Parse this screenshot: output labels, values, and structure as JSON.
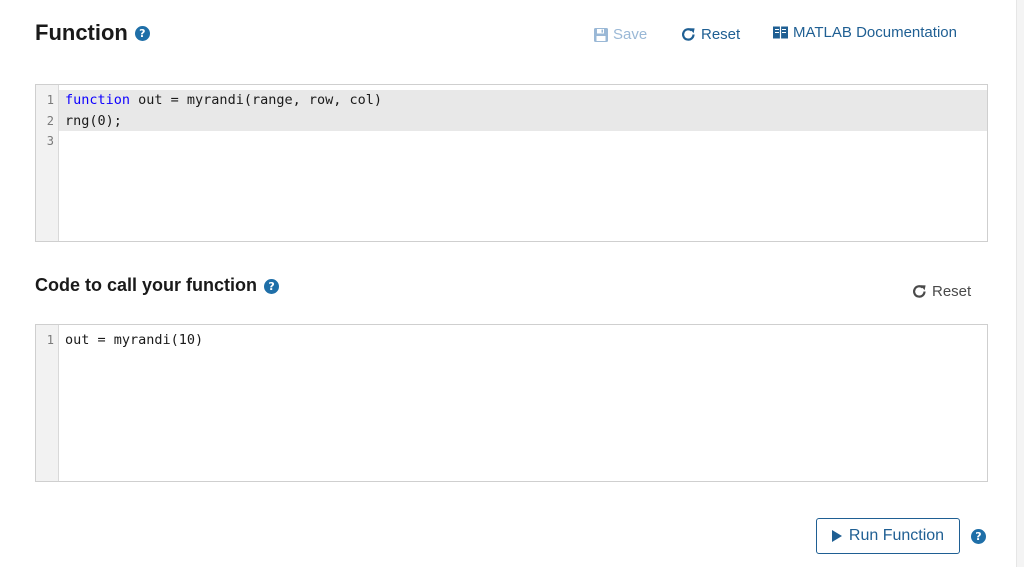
{
  "function_section": {
    "title": "Function",
    "help_glyph": "?",
    "toolbar": {
      "save_label": "Save",
      "reset_label": "Reset",
      "docs_label": "MATLAB Documentation"
    },
    "code_lines": [
      {
        "num": "1",
        "keyword": "function",
        "rest": " out = myrandi(range, row, col)"
      },
      {
        "num": "2",
        "keyword": "",
        "rest": "rng(0);"
      },
      {
        "num": "3",
        "keyword": "",
        "rest": ""
      }
    ]
  },
  "call_section": {
    "title": "Code to call your function",
    "help_glyph": "?",
    "reset_label": "Reset",
    "code_lines": [
      {
        "num": "1",
        "keyword": "",
        "rest": "out = myrandi(10)"
      }
    ]
  },
  "run": {
    "label": "Run Function",
    "help_glyph": "?"
  },
  "colors": {
    "accent": "#1f5f93",
    "help_icon": "#1f6fa8",
    "keyword": "#0e00ff",
    "disabled": "#9ab8d6"
  },
  "icons": {
    "save": "floppy-disk-icon",
    "reset": "refresh-icon",
    "docs": "book-icon",
    "run": "play-icon",
    "help": "question-circle-icon"
  }
}
